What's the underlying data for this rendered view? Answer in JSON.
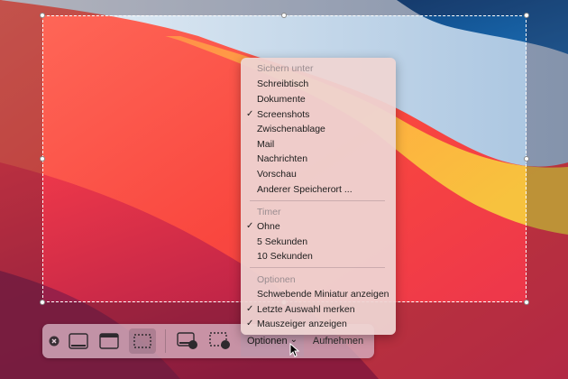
{
  "toolbar": {
    "options_label": "Optionen",
    "options_chevron": "⌄",
    "record_label": "Aufnehmen",
    "icons": [
      "close-icon",
      "capture-screen-icon",
      "capture-window-icon",
      "capture-selection-icon",
      "record-screen-icon",
      "record-selection-icon"
    ]
  },
  "menu": {
    "save_heading": "Sichern unter",
    "save_items": [
      {
        "label": "Schreibtisch",
        "checked": false
      },
      {
        "label": "Dokumente",
        "checked": false
      },
      {
        "label": "Screenshots",
        "checked": true
      },
      {
        "label": "Zwischenablage",
        "checked": false
      },
      {
        "label": "Mail",
        "checked": false
      },
      {
        "label": "Nachrichten",
        "checked": false
      },
      {
        "label": "Vorschau",
        "checked": false
      },
      {
        "label": "Anderer Speicherort ...",
        "checked": false
      }
    ],
    "timer_heading": "Timer",
    "timer_items": [
      {
        "label": "Ohne",
        "checked": true
      },
      {
        "label": "5 Sekunden",
        "checked": false
      },
      {
        "label": "10 Sekunden",
        "checked": false
      }
    ],
    "options_heading": "Optionen",
    "options_items": [
      {
        "label": "Schwebende Miniatur anzeigen",
        "checked": false
      },
      {
        "label": "Letzte Auswahl merken",
        "checked": true
      },
      {
        "label": "Mauszeiger anzeigen",
        "checked": true
      }
    ],
    "checkmark": "✓"
  },
  "colors": {
    "selection_border": "#ffffff",
    "menu_bg": "#eed4d2",
    "toolbar_bg": "#d7b4c3"
  }
}
